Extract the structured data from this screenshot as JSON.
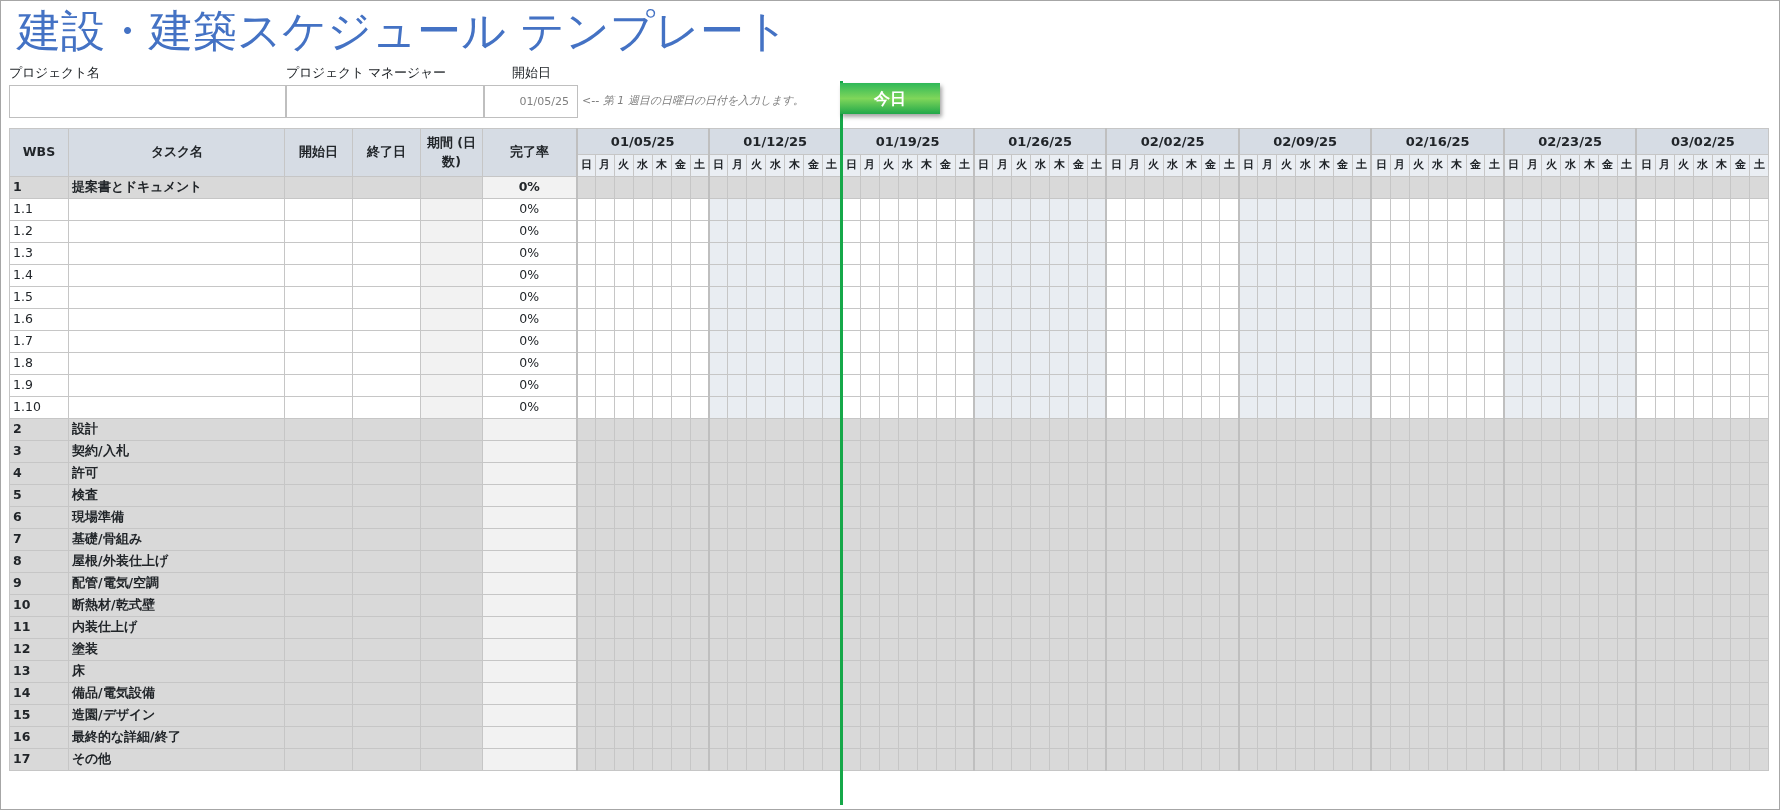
{
  "title": "建設・建築スケジュール テンプレート",
  "fields": [
    {
      "label": "プロジェクト名"
    },
    {
      "label": "プロジェクト マネージャー"
    },
    {
      "label": "開始日",
      "value": "01/05/25"
    }
  ],
  "hint": "<-- 第 1 週目の日曜日の日付を入力します。",
  "today_marker": {
    "label": "今日"
  },
  "columns": [
    "WBS",
    "タスク名",
    "開始日",
    "終了日",
    "**期間** (日数)",
    "完了率"
  ],
  "weeks": [
    {
      "label": "01/05/25",
      "days": [
        {
          "label": "日",
          "today": false
        },
        {
          "label": "月",
          "today": false
        },
        {
          "label": "火",
          "today": false
        },
        {
          "label": "水",
          "today": false
        },
        {
          "label": "木",
          "today": false
        },
        {
          "label": "金",
          "today": false
        },
        {
          "label": "土",
          "today": false
        }
      ]
    },
    {
      "label": "01/12/25",
      "days": [
        {
          "label": "日",
          "today": false
        },
        {
          "label": "月",
          "today": false
        },
        {
          "label": "火",
          "today": false
        },
        {
          "label": "水",
          "today": false
        },
        {
          "label": "木",
          "today": false
        },
        {
          "label": "金",
          "today": false
        },
        {
          "label": "土",
          "today": false
        }
      ]
    },
    {
      "label": "01/19/25",
      "days": [
        {
          "label": "日",
          "today": true
        },
        {
          "label": "月",
          "today": false
        },
        {
          "label": "火",
          "today": false
        },
        {
          "label": "水",
          "today": false
        },
        {
          "label": "木",
          "today": false
        },
        {
          "label": "金",
          "today": false
        },
        {
          "label": "土",
          "today": false
        }
      ]
    },
    {
      "label": "01/26/25",
      "days": [
        {
          "label": "日",
          "today": false
        },
        {
          "label": "月",
          "today": false
        },
        {
          "label": "火",
          "today": false
        },
        {
          "label": "水",
          "today": false
        },
        {
          "label": "木",
          "today": false
        },
        {
          "label": "金",
          "today": false
        },
        {
          "label": "土",
          "today": false
        }
      ]
    },
    {
      "label": "02/02/25",
      "days": [
        {
          "label": "日",
          "today": false
        },
        {
          "label": "月",
          "today": false
        },
        {
          "label": "火",
          "today": false
        },
        {
          "label": "水",
          "today": false
        },
        {
          "label": "木",
          "today": false
        },
        {
          "label": "金",
          "today": false
        },
        {
          "label": "土",
          "today": false
        }
      ]
    },
    {
      "label": "02/09/25",
      "days": [
        {
          "label": "日",
          "today": false
        },
        {
          "label": "月",
          "today": false
        },
        {
          "label": "火",
          "today": false
        },
        {
          "label": "水",
          "today": false
        },
        {
          "label": "木",
          "today": false
        },
        {
          "label": "金",
          "today": false
        },
        {
          "label": "土",
          "today": false
        }
      ]
    },
    {
      "label": "02/16/25",
      "days": [
        {
          "label": "日",
          "today": false
        },
        {
          "label": "月",
          "today": false
        },
        {
          "label": "火",
          "today": false
        },
        {
          "label": "水",
          "today": false
        },
        {
          "label": "木",
          "today": false
        },
        {
          "label": "金",
          "today": false
        },
        {
          "label": "土",
          "today": false
        }
      ]
    },
    {
      "label": "02/23/25",
      "days": [
        {
          "label": "日",
          "today": false
        },
        {
          "label": "月",
          "today": false
        },
        {
          "label": "火",
          "today": false
        },
        {
          "label": "水",
          "today": false
        },
        {
          "label": "木",
          "today": false
        },
        {
          "label": "金",
          "today": false
        },
        {
          "label": "土",
          "today": false
        }
      ]
    },
    {
      "label": "03/02/25",
      "days": [
        {
          "label": "日",
          "today": false
        },
        {
          "label": "月",
          "today": false
        },
        {
          "label": "火",
          "today": false
        },
        {
          "label": "水",
          "today": false
        },
        {
          "label": "木",
          "today": false
        },
        {
          "label": "金",
          "today": false
        },
        {
          "label": "土",
          "today": false
        }
      ]
    }
  ],
  "rows": [
    {
      "kind": "group",
      "wbs": "1",
      "task": "提案書とドキュメント",
      "pct": "0%"
    },
    {
      "kind": "task",
      "wbs": "1.1",
      "pct": "0%"
    },
    {
      "kind": "task",
      "wbs": "1.2",
      "pct": "0%"
    },
    {
      "kind": "task",
      "wbs": "1.3",
      "pct": "0%"
    },
    {
      "kind": "task",
      "wbs": "1.4",
      "pct": "0%"
    },
    {
      "kind": "task",
      "wbs": "1.5",
      "pct": "0%"
    },
    {
      "kind": "task",
      "wbs": "1.6",
      "pct": "0%"
    },
    {
      "kind": "task",
      "wbs": "1.7",
      "pct": "0%"
    },
    {
      "kind": "task",
      "wbs": "1.8",
      "pct": "0%"
    },
    {
      "kind": "task",
      "wbs": "1.9",
      "pct": "0%"
    },
    {
      "kind": "task",
      "wbs": "1.10",
      "pct": "0%"
    },
    {
      "kind": "group",
      "wbs": "2",
      "task": "設計"
    },
    {
      "kind": "group",
      "wbs": "3",
      "task": "契約/入札"
    },
    {
      "kind": "group",
      "wbs": "4",
      "task": "許可"
    },
    {
      "kind": "group",
      "wbs": "5",
      "task": "検査"
    },
    {
      "kind": "group",
      "wbs": "6",
      "task": "現場準備"
    },
    {
      "kind": "group",
      "wbs": "7",
      "task": "基礎/骨組み"
    },
    {
      "kind": "group",
      "wbs": "8",
      "task": "屋根/外装仕上げ"
    },
    {
      "kind": "group",
      "wbs": "9",
      "task": "配管/電気/空調"
    },
    {
      "kind": "group",
      "wbs": "10",
      "task": "断熱材/乾式壁"
    },
    {
      "kind": "group",
      "wbs": "11",
      "task": "内装仕上げ"
    },
    {
      "kind": "group",
      "wbs": "12",
      "task": "塗装"
    },
    {
      "kind": "group",
      "wbs": "13",
      "task": "床"
    },
    {
      "kind": "group",
      "wbs": "14",
      "task": "備品/電気設備"
    },
    {
      "kind": "group",
      "wbs": "15",
      "task": "造園/デザイン"
    },
    {
      "kind": "group",
      "wbs": "16",
      "task": "最終的な詳細/終了"
    },
    {
      "kind": "group",
      "wbs": "17",
      "task": "その他"
    }
  ]
}
